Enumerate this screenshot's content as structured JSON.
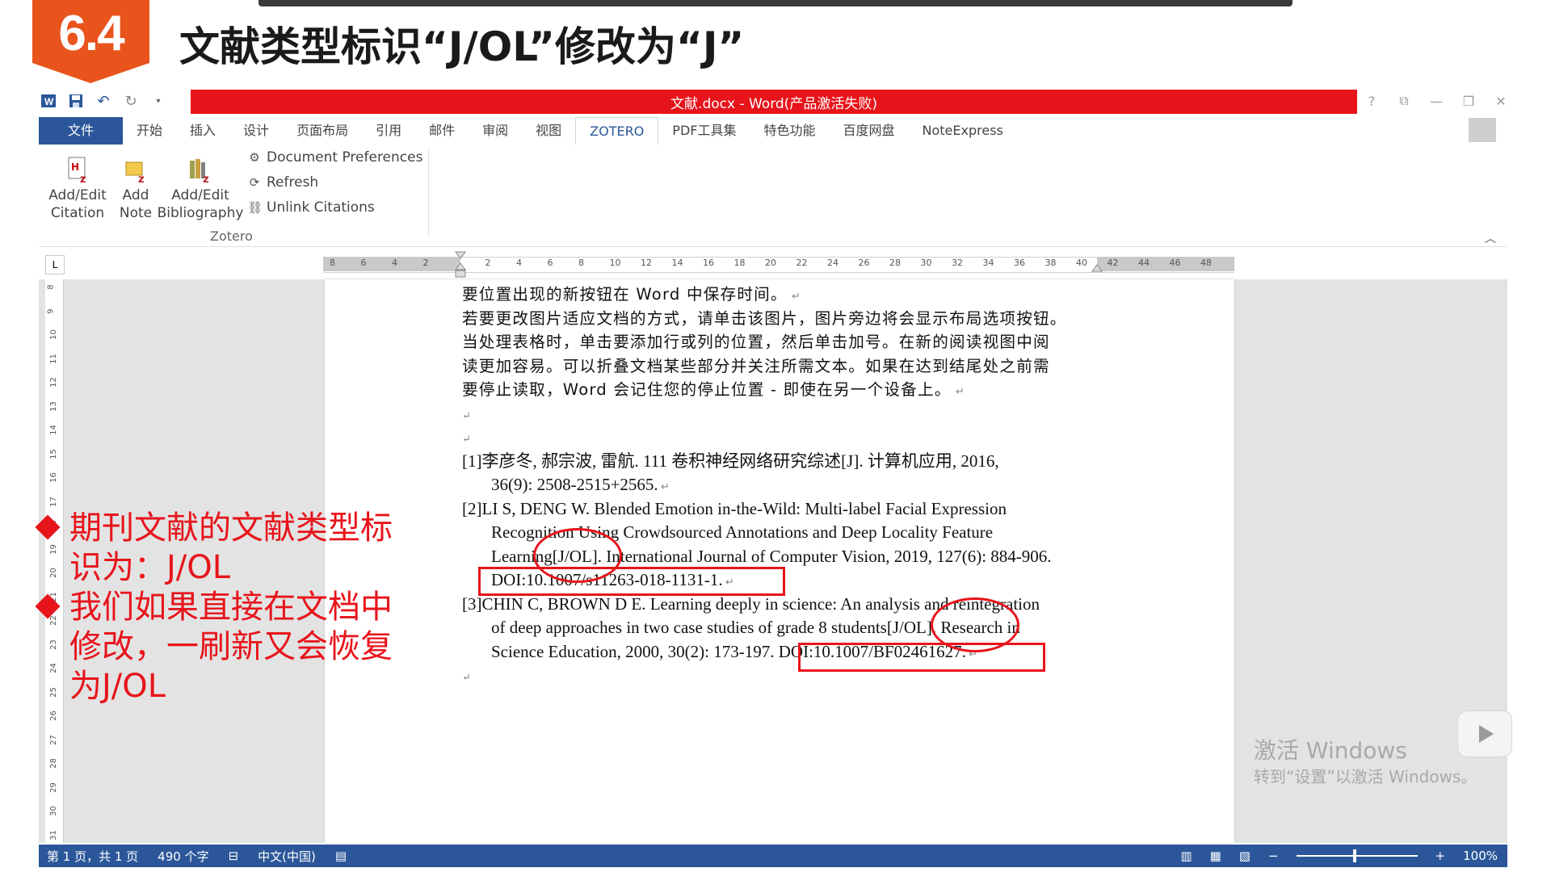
{
  "slide": {
    "number": "6.4",
    "title": "文献类型标识“J/OL”修改为“J”",
    "badge_color": "#e8541b"
  },
  "window": {
    "title": "文献.docx - Word(产品激活失败)",
    "titlebar_color": "#e8141b",
    "controls": [
      "?",
      "⧉",
      "—",
      "❐",
      "✕"
    ]
  },
  "ribbon": {
    "tabs": [
      "文件",
      "开始",
      "插入",
      "设计",
      "页面布局",
      "引用",
      "邮件",
      "审阅",
      "视图",
      "ZOTERO",
      "PDF工具集",
      "特色功能",
      "百度网盘",
      "NoteExpress"
    ],
    "active_tab": "ZOTERO",
    "zotero": {
      "add_edit_citation": "Add/Edit\nCitation",
      "add_note": "Add\nNote",
      "add_edit_bibliography": "Add/Edit\nBibliography",
      "document_preferences": "Document Preferences",
      "refresh": "Refresh",
      "unlink_citations": "Unlink Citations",
      "group_label": "Zotero"
    }
  },
  "ruler": {
    "ticks": [
      "8",
      "6",
      "4",
      "2",
      "",
      "2",
      "4",
      "6",
      "8",
      "10",
      "12",
      "14",
      "16",
      "18",
      "20",
      "22",
      "24",
      "26",
      "28",
      "30",
      "32",
      "34",
      "36",
      "38",
      "40",
      "42",
      "44",
      "46",
      "48"
    ],
    "vticks": [
      "8",
      "9",
      "10",
      "11",
      "12",
      "13",
      "14",
      "15",
      "16",
      "17",
      "18",
      "19",
      "20",
      "21",
      "22",
      "23",
      "24",
      "25",
      "26",
      "27",
      "28",
      "29",
      "30",
      "31"
    ]
  },
  "document": {
    "paragraph_lines": [
      "要位置出现的新按钮在 Word 中保存时间。",
      "若要更改图片适应文档的方式，请单击该图片，图片旁边将会显示布局选项按钮。",
      "当处理表格时，单击要添加行或列的位置，然后单击加号。在新的阅读视图中阅",
      "读更加容易。可以折叠文档某些部分并关注所需文本。如果在达到结尾处之前需",
      "要停止读取，Word 会记住您的停止位置 - 即使在另一个设备上。"
    ],
    "references": [
      {
        "line1": "[1]李彦冬, 郝宗波, 雷航. 111 卷积神经网络研究综述[J]. 计算机应用, 2016,",
        "line2": "36(9): 2508-2515+2565."
      },
      {
        "line1": "[2]LI S, DENG W. Blended Emotion in-the-Wild: Multi-label Facial Expression",
        "line2": "Recognition Using Crowdsourced Annotations and Deep Locality Feature",
        "line3": "Learning[J/OL]. International Journal of Computer Vision, 2019, 127(6): 884-906.",
        "line4": "DOI:10.1007/s11263-018-1131-1."
      },
      {
        "line1": "[3]CHIN C, BROWN D E. Learning deeply in science: An analysis and reintegration",
        "line2": "of deep approaches in two case studies of grade 8 students[J/OL]. Research in",
        "line3": "Science Education, 2000, 30(2): 173-197. DOI:10.1007/BF02461627."
      }
    ]
  },
  "annotation": {
    "color": "#e8141b",
    "items": [
      "期刊文献的文献类型标识为：J/OL",
      "我们如果直接在文档中修改，一刷新又会恢复为J/OL"
    ]
  },
  "status": {
    "page": "第 1 页，共 1 页",
    "words": "490 个字",
    "language": "中文(中国)",
    "zoom": "100%",
    "bar_color": "#2b579a"
  },
  "watermark": {
    "line1": "激活 Windows",
    "line2": "转到“设置”以激活 Windows。"
  }
}
